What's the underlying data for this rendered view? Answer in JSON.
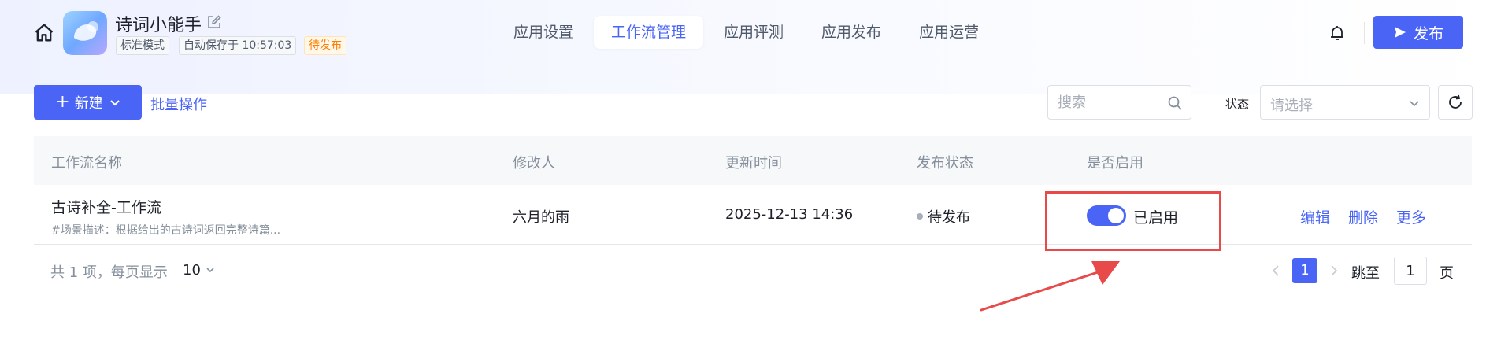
{
  "header": {
    "app_name": "诗词小能手",
    "tags": {
      "mode": "标准模式",
      "autosave": "自动保存于 10:57:03",
      "status": "待发布"
    },
    "nav_tabs": [
      {
        "label": "应用设置",
        "active": false
      },
      {
        "label": "工作流管理",
        "active": true
      },
      {
        "label": "应用评测",
        "active": false
      },
      {
        "label": "应用发布",
        "active": false
      },
      {
        "label": "应用运营",
        "active": false
      }
    ],
    "publish_label": "发布"
  },
  "toolbar": {
    "new_label": "新建",
    "batch_label": "批量操作",
    "search_placeholder": "搜索",
    "status_label": "状态",
    "status_placeholder": "请选择"
  },
  "table": {
    "columns": [
      "工作流名称",
      "修改人",
      "更新时间",
      "发布状态",
      "是否启用"
    ],
    "rows": [
      {
        "name": "古诗补全-工作流",
        "description": "#场景描述：根据给出的古诗词返回完整诗篇...",
        "modifier": "六月的雨",
        "updated": "2025-12-13 14:36",
        "publish_status": "待发布",
        "enabled": true,
        "enabled_label": "已启用",
        "actions": [
          "编辑",
          "删除",
          "更多"
        ]
      }
    ]
  },
  "pagination": {
    "total_text": "共 1 项，每页显示",
    "page_size": "10",
    "current_page": "1",
    "jump_label": "跳至",
    "jump_value": "1",
    "page_suffix": "页"
  },
  "colors": {
    "primary": "#4a65f6",
    "annotation": "#e84949",
    "pending": "#ff7d00"
  }
}
